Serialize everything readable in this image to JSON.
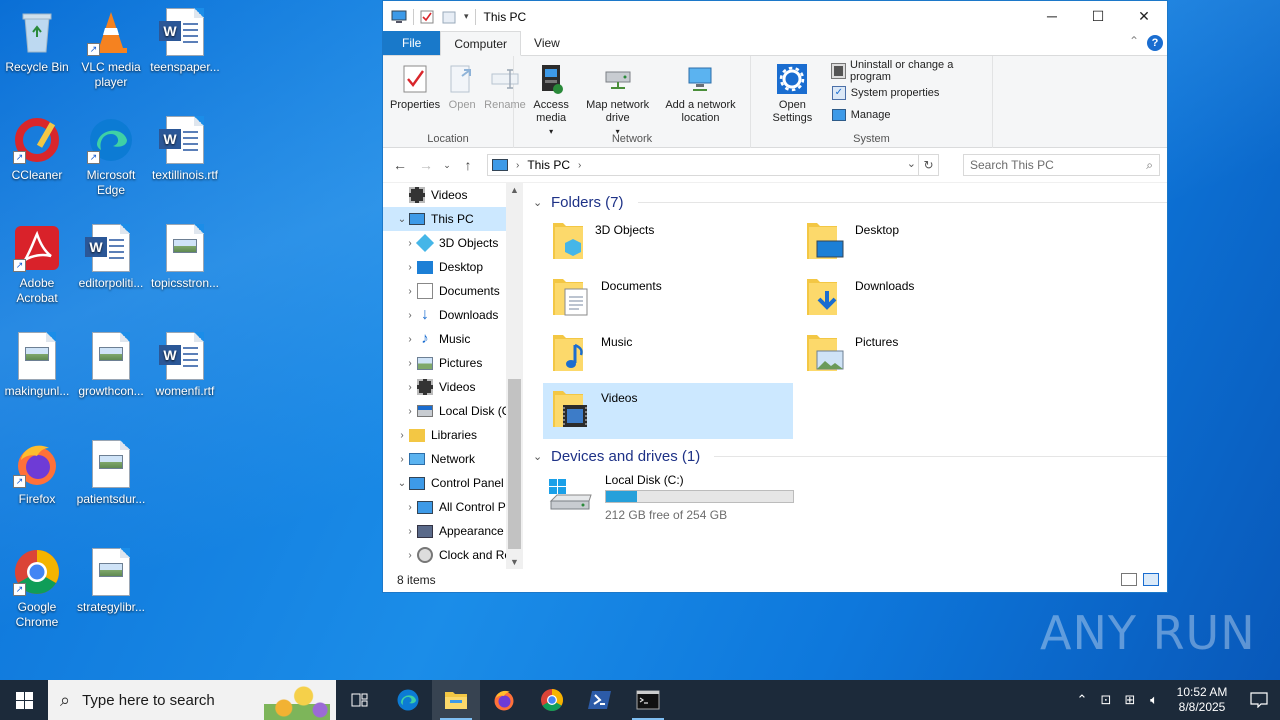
{
  "desktop": {
    "icons": [
      {
        "label": "Recycle Bin"
      },
      {
        "label": "VLC media player"
      },
      {
        "label": "teenspaper..."
      },
      {
        "label": "CCleaner"
      },
      {
        "label": "Microsoft Edge"
      },
      {
        "label": "textillinois.rtf"
      },
      {
        "label": "Adobe Acrobat"
      },
      {
        "label": "editorpoliti..."
      },
      {
        "label": "topicsstron..."
      },
      {
        "label": "makingunl..."
      },
      {
        "label": "growthcon..."
      },
      {
        "label": "womenfi.rtf"
      },
      {
        "label": "Firefox"
      },
      {
        "label": "patientsdur..."
      },
      {
        "label": "Google Chrome"
      },
      {
        "label": "strategylibr..."
      }
    ]
  },
  "window": {
    "title": "This PC",
    "tabs": {
      "file": "File",
      "computer": "Computer",
      "view": "View"
    },
    "ribbon": {
      "location": {
        "group_name": "Location",
        "properties": "Properties",
        "open": "Open",
        "rename": "Rename"
      },
      "network": {
        "group_name": "Network",
        "access_media": "Access media",
        "map_network_drive": "Map network drive",
        "add_network_location": "Add a network location"
      },
      "system": {
        "group_name": "System",
        "open_settings": "Open Settings",
        "uninstall": "Uninstall or change a program",
        "system_properties": "System properties",
        "manage": "Manage"
      }
    },
    "address": {
      "crumb": "This PC"
    },
    "search": {
      "placeholder": "Search This PC"
    },
    "nav": [
      {
        "label": "Videos"
      },
      {
        "label": "This PC"
      },
      {
        "label": "3D Objects"
      },
      {
        "label": "Desktop"
      },
      {
        "label": "Documents"
      },
      {
        "label": "Downloads"
      },
      {
        "label": "Music"
      },
      {
        "label": "Pictures"
      },
      {
        "label": "Videos"
      },
      {
        "label": "Local Disk (C:)"
      },
      {
        "label": "Libraries"
      },
      {
        "label": "Network"
      },
      {
        "label": "Control Panel"
      },
      {
        "label": "All Control Par"
      },
      {
        "label": "Appearance an"
      },
      {
        "label": "Clock and Regi"
      }
    ],
    "folders_header": "Folders (7)",
    "folders": [
      {
        "name": "3D Objects"
      },
      {
        "name": "Desktop"
      },
      {
        "name": "Documents"
      },
      {
        "name": "Downloads"
      },
      {
        "name": "Music"
      },
      {
        "name": "Pictures"
      },
      {
        "name": "Videos"
      }
    ],
    "devices_header": "Devices and drives (1)",
    "drive": {
      "name": "Local Disk (C:)",
      "free_text": "212 GB free of 254 GB",
      "used_fraction": 0.165
    },
    "status": "8 items"
  },
  "taskbar": {
    "search_placeholder": "Type here to search",
    "time": "10:52 AM",
    "date": "8/8/2025"
  },
  "watermark": "ANY RUN",
  "colors": {
    "accent": "#1979ca",
    "selection": "#cce8ff",
    "folder": "#f3c744",
    "taskbar": "#1c2a3a"
  }
}
